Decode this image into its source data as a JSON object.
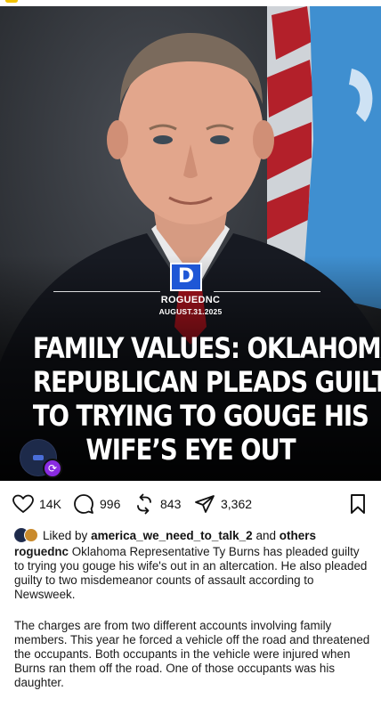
{
  "post_image": {
    "brand_letter": "D",
    "brand_name": "ROGUEDNC",
    "date": "AUGUST.31.2025",
    "headline_lines": [
      "FAMILY VALUES: OKLAHOMA",
      "REPUBLICAN PLEADS GUILTY",
      "TO TRYING TO GOUGE HIS",
      "WIFE’S EYE OUT"
    ]
  },
  "actions": {
    "likes_count": "14K",
    "comments_count": "996",
    "reposts_count": "843",
    "shares_count": "3,362"
  },
  "liked_by": {
    "prefix": "Liked by",
    "user": "america_we_need_to_talk_2",
    "and": "and",
    "others": "others"
  },
  "caption": {
    "username": "roguednc",
    "text": "Oklahoma Representative Ty Burns has pleaded guilty to trying you gouge his wife's out in an altercation. He also pleaded guilty to two misdemeanor counts of assault according to Newsweek.",
    "paragraph2": "The charges are from two different accounts involving family members. This year he forced a vehicle off the road and threatened the occupants. Both occupants in the vehicle were injured when Burns ran them off the road. One of those occupants was his daughter."
  },
  "colors": {
    "brand_blue": "#1f57d6",
    "collab_purple": "#8a2be2",
    "flag_blue": "#3f8fd0",
    "flag_red": "#b3202a"
  }
}
